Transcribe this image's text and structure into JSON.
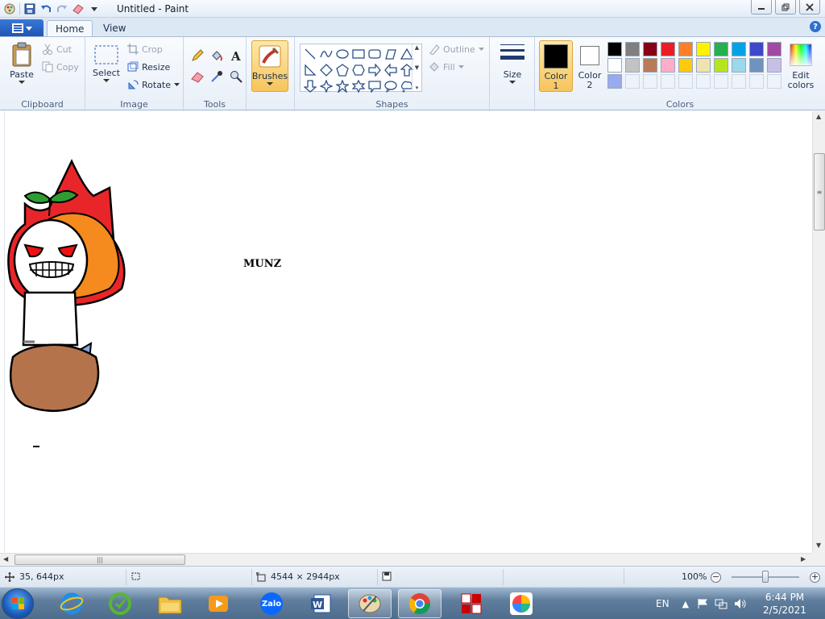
{
  "window": {
    "title": "Untitled - Paint"
  },
  "tabs": {
    "home": "Home",
    "view": "View"
  },
  "ribbon": {
    "clipboard": {
      "label": "Clipboard",
      "paste": "Paste",
      "cut": "Cut",
      "copy": "Copy"
    },
    "image": {
      "label": "Image",
      "select": "Select",
      "crop": "Crop",
      "resize": "Resize",
      "rotate": "Rotate"
    },
    "tools": {
      "label": "Tools"
    },
    "brushes": {
      "label": "Brushes"
    },
    "shapes": {
      "label": "Shapes",
      "outline": "Outline",
      "fill": "Fill"
    },
    "size": {
      "label": "Size"
    },
    "colors": {
      "label": "Colors",
      "color1_label": "Color",
      "color1_num": "1",
      "color2_label": "Color",
      "color2_num": "2",
      "edit_label": "Edit",
      "edit_label2": "colors",
      "color1": "#000000",
      "color2": "#ffffff",
      "palette": [
        "#000000",
        "#7f7f7f",
        "#880015",
        "#ed1c24",
        "#ff7f27",
        "#fff200",
        "#22b14c",
        "#00a2e8",
        "#3f48cc",
        "#a349a4",
        "#ffffff",
        "#c3c3c3",
        "#b97a57",
        "#ffaec9",
        "#ffc90e",
        "#efe4b0",
        "#b5e61d",
        "#99d9ea",
        "#7092be",
        "#c8bfe7",
        "#99aaee",
        "",
        "",
        "",
        "",
        "",
        "",
        "",
        "",
        ""
      ]
    }
  },
  "canvas": {
    "text": "MUNZ"
  },
  "statusbar": {
    "cursor_pos": "35, 644px",
    "image_size": "4544 × 2944px",
    "zoom": "100%"
  },
  "taskbar": {
    "language": "EN",
    "time": "6:44 PM",
    "date": "2/5/2021",
    "zalo": "Zalo"
  }
}
